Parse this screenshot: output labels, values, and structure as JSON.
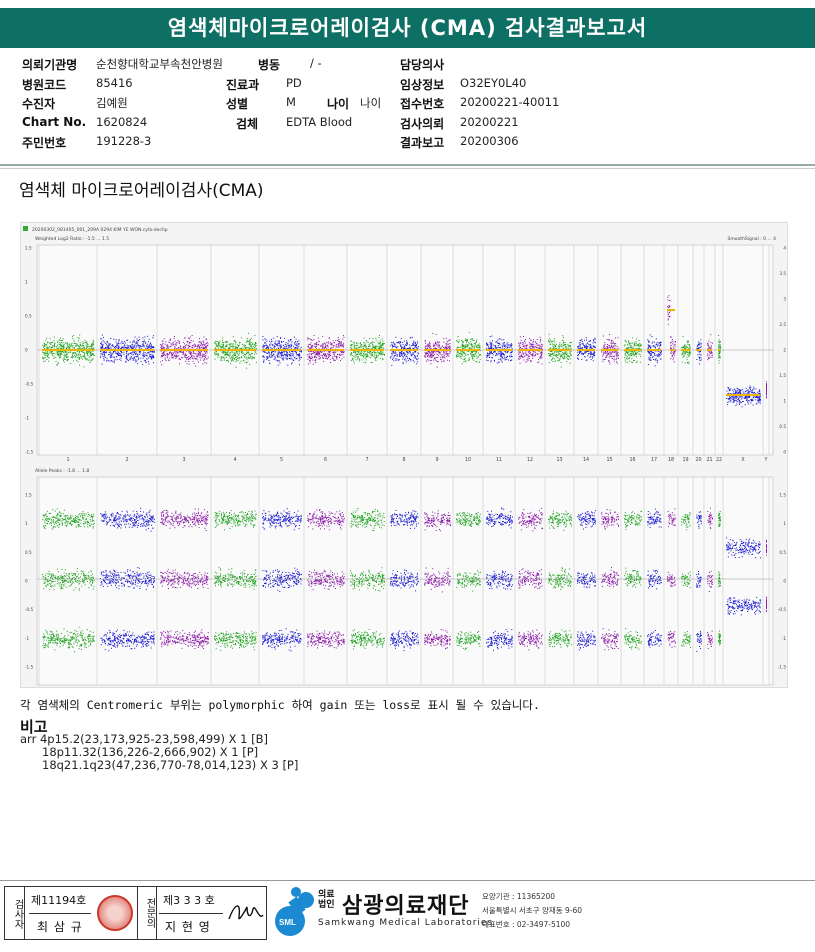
{
  "title": "염색체마이크로어레이검사 (CMA) 검사결과보고서",
  "patient_info": {
    "institution_label": "의뢰기관명",
    "institution": "순천향대학교부속천안병원",
    "ward_label": "병동",
    "ward": "/ -",
    "physician_label": "담당의사",
    "physician": "",
    "hospital_code_label": "병원코드",
    "hospital_code": "85416",
    "department_label": "진료과",
    "department": "PD",
    "clinical_info_label": "임상정보",
    "clinical_info": "O32EY0L40",
    "name_label": "수진자",
    "name": "김예원",
    "sex_label": "성별",
    "sex": "M",
    "age_label": "나이",
    "age": "나이",
    "reception_no_label": "접수번호",
    "reception_no": "20200221-40011",
    "chart_no_label": "Chart No.",
    "chart_no": "1620824",
    "specimen_label": "검체",
    "specimen": "EDTA Blood",
    "request_date_label": "검사의뢰",
    "request_date": "20200221",
    "resident_no_label": "주민번호",
    "resident_no": "191228-3",
    "report_date_label": "결과보고",
    "report_date": "20200306"
  },
  "section_title": "염색체 마이크로어레이검사(CMA)",
  "plot": {
    "file_name": "20200302_081405_001_209A 0294 KIM YE WON.cyto.dechp",
    "panel1_title": "Weighted Log2 Ratio : -1.5 ... 1.5",
    "panel1_right_title": "SmoothSignal : 0 ... 4",
    "panel2_title": "Allele Peaks : -1.8 ... 1.8",
    "left_ticks_top": [
      "1.5",
      "1",
      "0.5",
      "0",
      "-0.5",
      "-1",
      "-1.5"
    ],
    "right_ticks_top": [
      "4",
      "3.5",
      "3",
      "2.5",
      "2",
      "1.5",
      "1",
      "0.5",
      "0"
    ],
    "left_ticks_bottom": [
      "1.5",
      "1",
      "0.5",
      "0",
      "-0.5",
      "-1",
      "-1.5"
    ],
    "right_ticks_bottom": [
      "1.5",
      "1",
      "0.5",
      "0",
      "-0.5",
      "-1",
      "-1.5"
    ],
    "chromosome_labels": [
      "1",
      "2",
      "3",
      "4",
      "5",
      "6",
      "7",
      "8",
      "9",
      "10",
      "11",
      "12",
      "13",
      "14",
      "15",
      "16",
      "17",
      "18",
      "19",
      "20",
      "21",
      "22",
      "X",
      "Y"
    ],
    "colors": {
      "green": "#1fa21f",
      "blue": "#1a1ad0",
      "purple": "#8a1aa8",
      "smooth": "#f0b400"
    }
  },
  "note": "각 염색체의 Centromeric 부위는 polymorphic 하여 gain 또는 loss로 표시 될 수 있습니다.",
  "remarks_title": "비고",
  "remarks": [
    "arr 4p15.2(23,173,925-23,598,499) X 1 [B]",
    "18p11.32(136,226-2,666,902) X 1 [P]",
    "18q21.1q23(47,236,770-78,014,123) X 3 [P]"
  ],
  "footer": {
    "examiner_label": "검사자",
    "examiner_no": "제11194호",
    "examiner_name": "최 삼 규",
    "specialist_label": "전문의",
    "specialist_no": "제3 3 3 호",
    "specialist_name": "지 현 영",
    "logo_text": "SML",
    "org_type": "의료법인",
    "org_name": "삼광의료재단",
    "org_english": "Samkwang Medical Laboratories",
    "license": "요양기관 : 11365200",
    "address": "서울특별시 서초구 양재동 9-60",
    "phone": "대표번호 : 02-3497-5100"
  }
}
